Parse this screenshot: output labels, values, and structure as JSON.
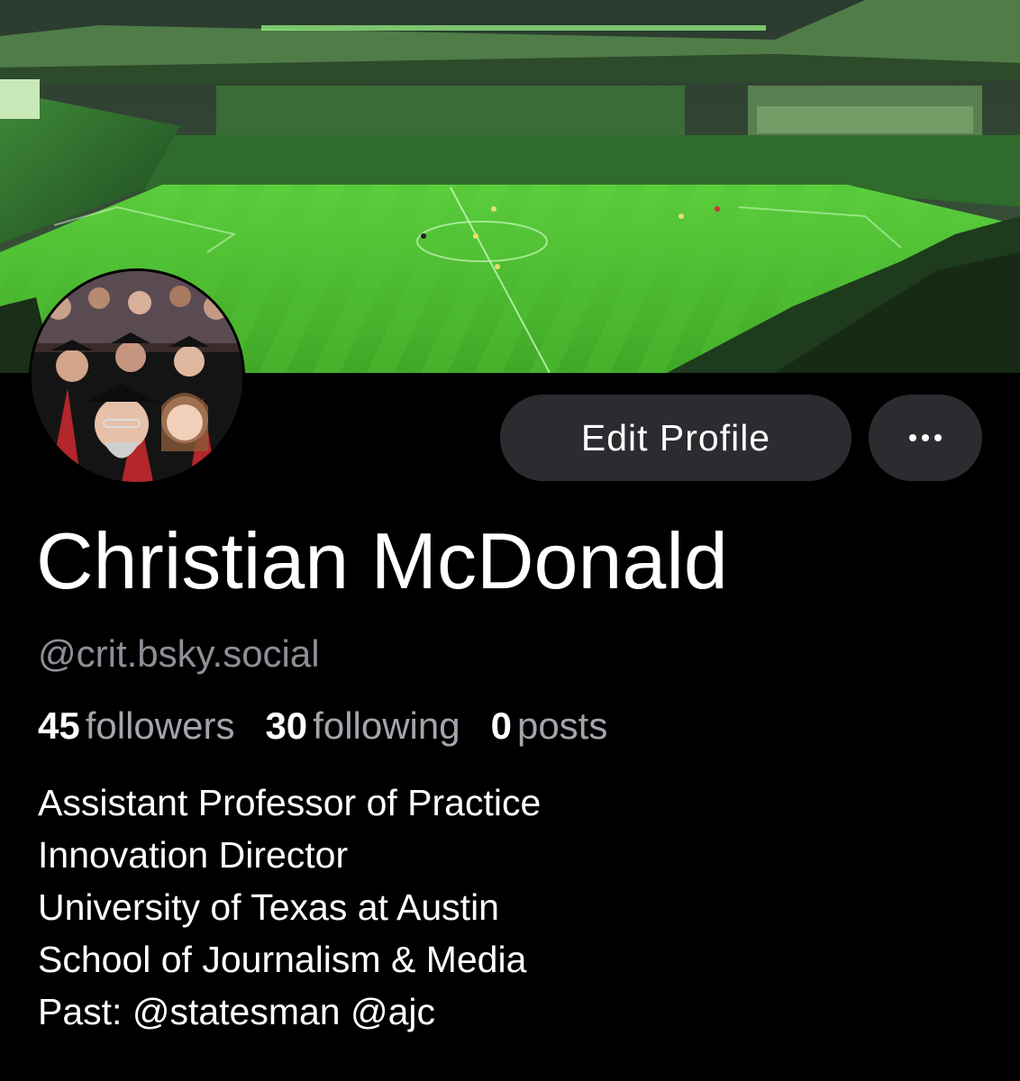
{
  "profile": {
    "display_name": "Christian McDonald",
    "handle": "@crit.bsky.social",
    "stats": [
      {
        "value": "45",
        "label": "followers"
      },
      {
        "value": "30",
        "label": "following"
      },
      {
        "value": "0",
        "label": "posts"
      }
    ],
    "bio_lines": [
      "Assistant Professor of Practice",
      "Innovation Director",
      "University of Texas at Austin",
      "School of Journalism & Media",
      "Past: @statesman @ajc"
    ]
  },
  "actions": {
    "edit_profile_label": "Edit Profile",
    "more_icon": "ellipsis-icon"
  },
  "banner": {
    "description_icon": "stadium-banner-image",
    "accent_color": "#5fcf4a"
  },
  "colors": {
    "background": "#000000",
    "button_bg": "#2b2c30",
    "secondary_text": "#8d8f97"
  }
}
